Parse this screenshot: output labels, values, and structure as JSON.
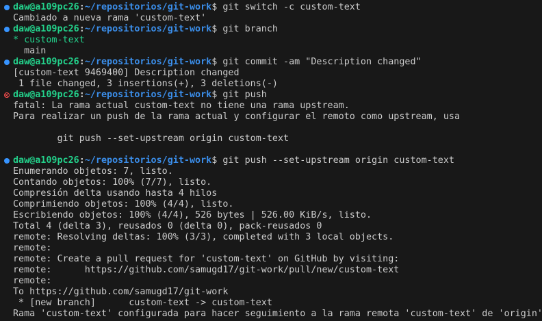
{
  "colors": {
    "background": "#181818",
    "text": "#cccccc",
    "user_host": "#23d18b",
    "path": "#3b8eea",
    "success_marker": "#3794ff",
    "error_marker": "#f14c4c"
  },
  "prompt": {
    "user_host": "daw@a109pc26",
    "separator": ":",
    "path": "~/repositorios/git-work",
    "symbol": "$"
  },
  "lines": [
    {
      "type": "prompt",
      "status": "success",
      "command": " git switch -c custom-text"
    },
    {
      "type": "output",
      "text": "Cambiado a nueva rama 'custom-text'"
    },
    {
      "type": "prompt",
      "status": "success",
      "command": " git branch"
    },
    {
      "type": "output",
      "text": "* custom-text",
      "color": "green"
    },
    {
      "type": "output",
      "text": "  main"
    },
    {
      "type": "prompt",
      "status": "success",
      "command": " git commit -am \"Description changed\""
    },
    {
      "type": "output",
      "text": "[custom-text 9469400] Description changed"
    },
    {
      "type": "output",
      "text": " 1 file changed, 3 insertions(+), 3 deletions(-)"
    },
    {
      "type": "prompt",
      "status": "error",
      "command": " git push"
    },
    {
      "type": "output",
      "text": "fatal: La rama actual custom-text no tiene una rama upstream."
    },
    {
      "type": "output",
      "text": "Para realizar un push de la rama actual y configurar el remoto como upstream, usa"
    },
    {
      "type": "output",
      "text": ""
    },
    {
      "type": "output",
      "text": "        git push --set-upstream origin custom-text"
    },
    {
      "type": "output",
      "text": ""
    },
    {
      "type": "prompt",
      "status": "success",
      "command": " git push --set-upstream origin custom-text"
    },
    {
      "type": "output",
      "text": "Enumerando objetos: 7, listo."
    },
    {
      "type": "output",
      "text": "Contando objetos: 100% (7/7), listo."
    },
    {
      "type": "output",
      "text": "Compresión delta usando hasta 4 hilos"
    },
    {
      "type": "output",
      "text": "Comprimiendo objetos: 100% (4/4), listo."
    },
    {
      "type": "output",
      "text": "Escribiendo objetos: 100% (4/4), 526 bytes | 526.00 KiB/s, listo."
    },
    {
      "type": "output",
      "text": "Total 4 (delta 3), reusados 0 (delta 0), pack-reusados 0"
    },
    {
      "type": "output",
      "text": "remote: Resolving deltas: 100% (3/3), completed with 3 local objects."
    },
    {
      "type": "output",
      "text": "remote: "
    },
    {
      "type": "output",
      "text": "remote: Create a pull request for 'custom-text' on GitHub by visiting:"
    },
    {
      "type": "output",
      "text": "remote:      https://github.com/samugd17/git-work/pull/new/custom-text"
    },
    {
      "type": "output",
      "text": "remote: "
    },
    {
      "type": "output",
      "text": "To https://github.com/samugd17/git-work"
    },
    {
      "type": "output",
      "text": " * [new branch]      custom-text -> custom-text"
    },
    {
      "type": "output",
      "text": "Rama 'custom-text' configurada para hacer seguimiento a la rama remota 'custom-text' de 'origin'."
    }
  ]
}
